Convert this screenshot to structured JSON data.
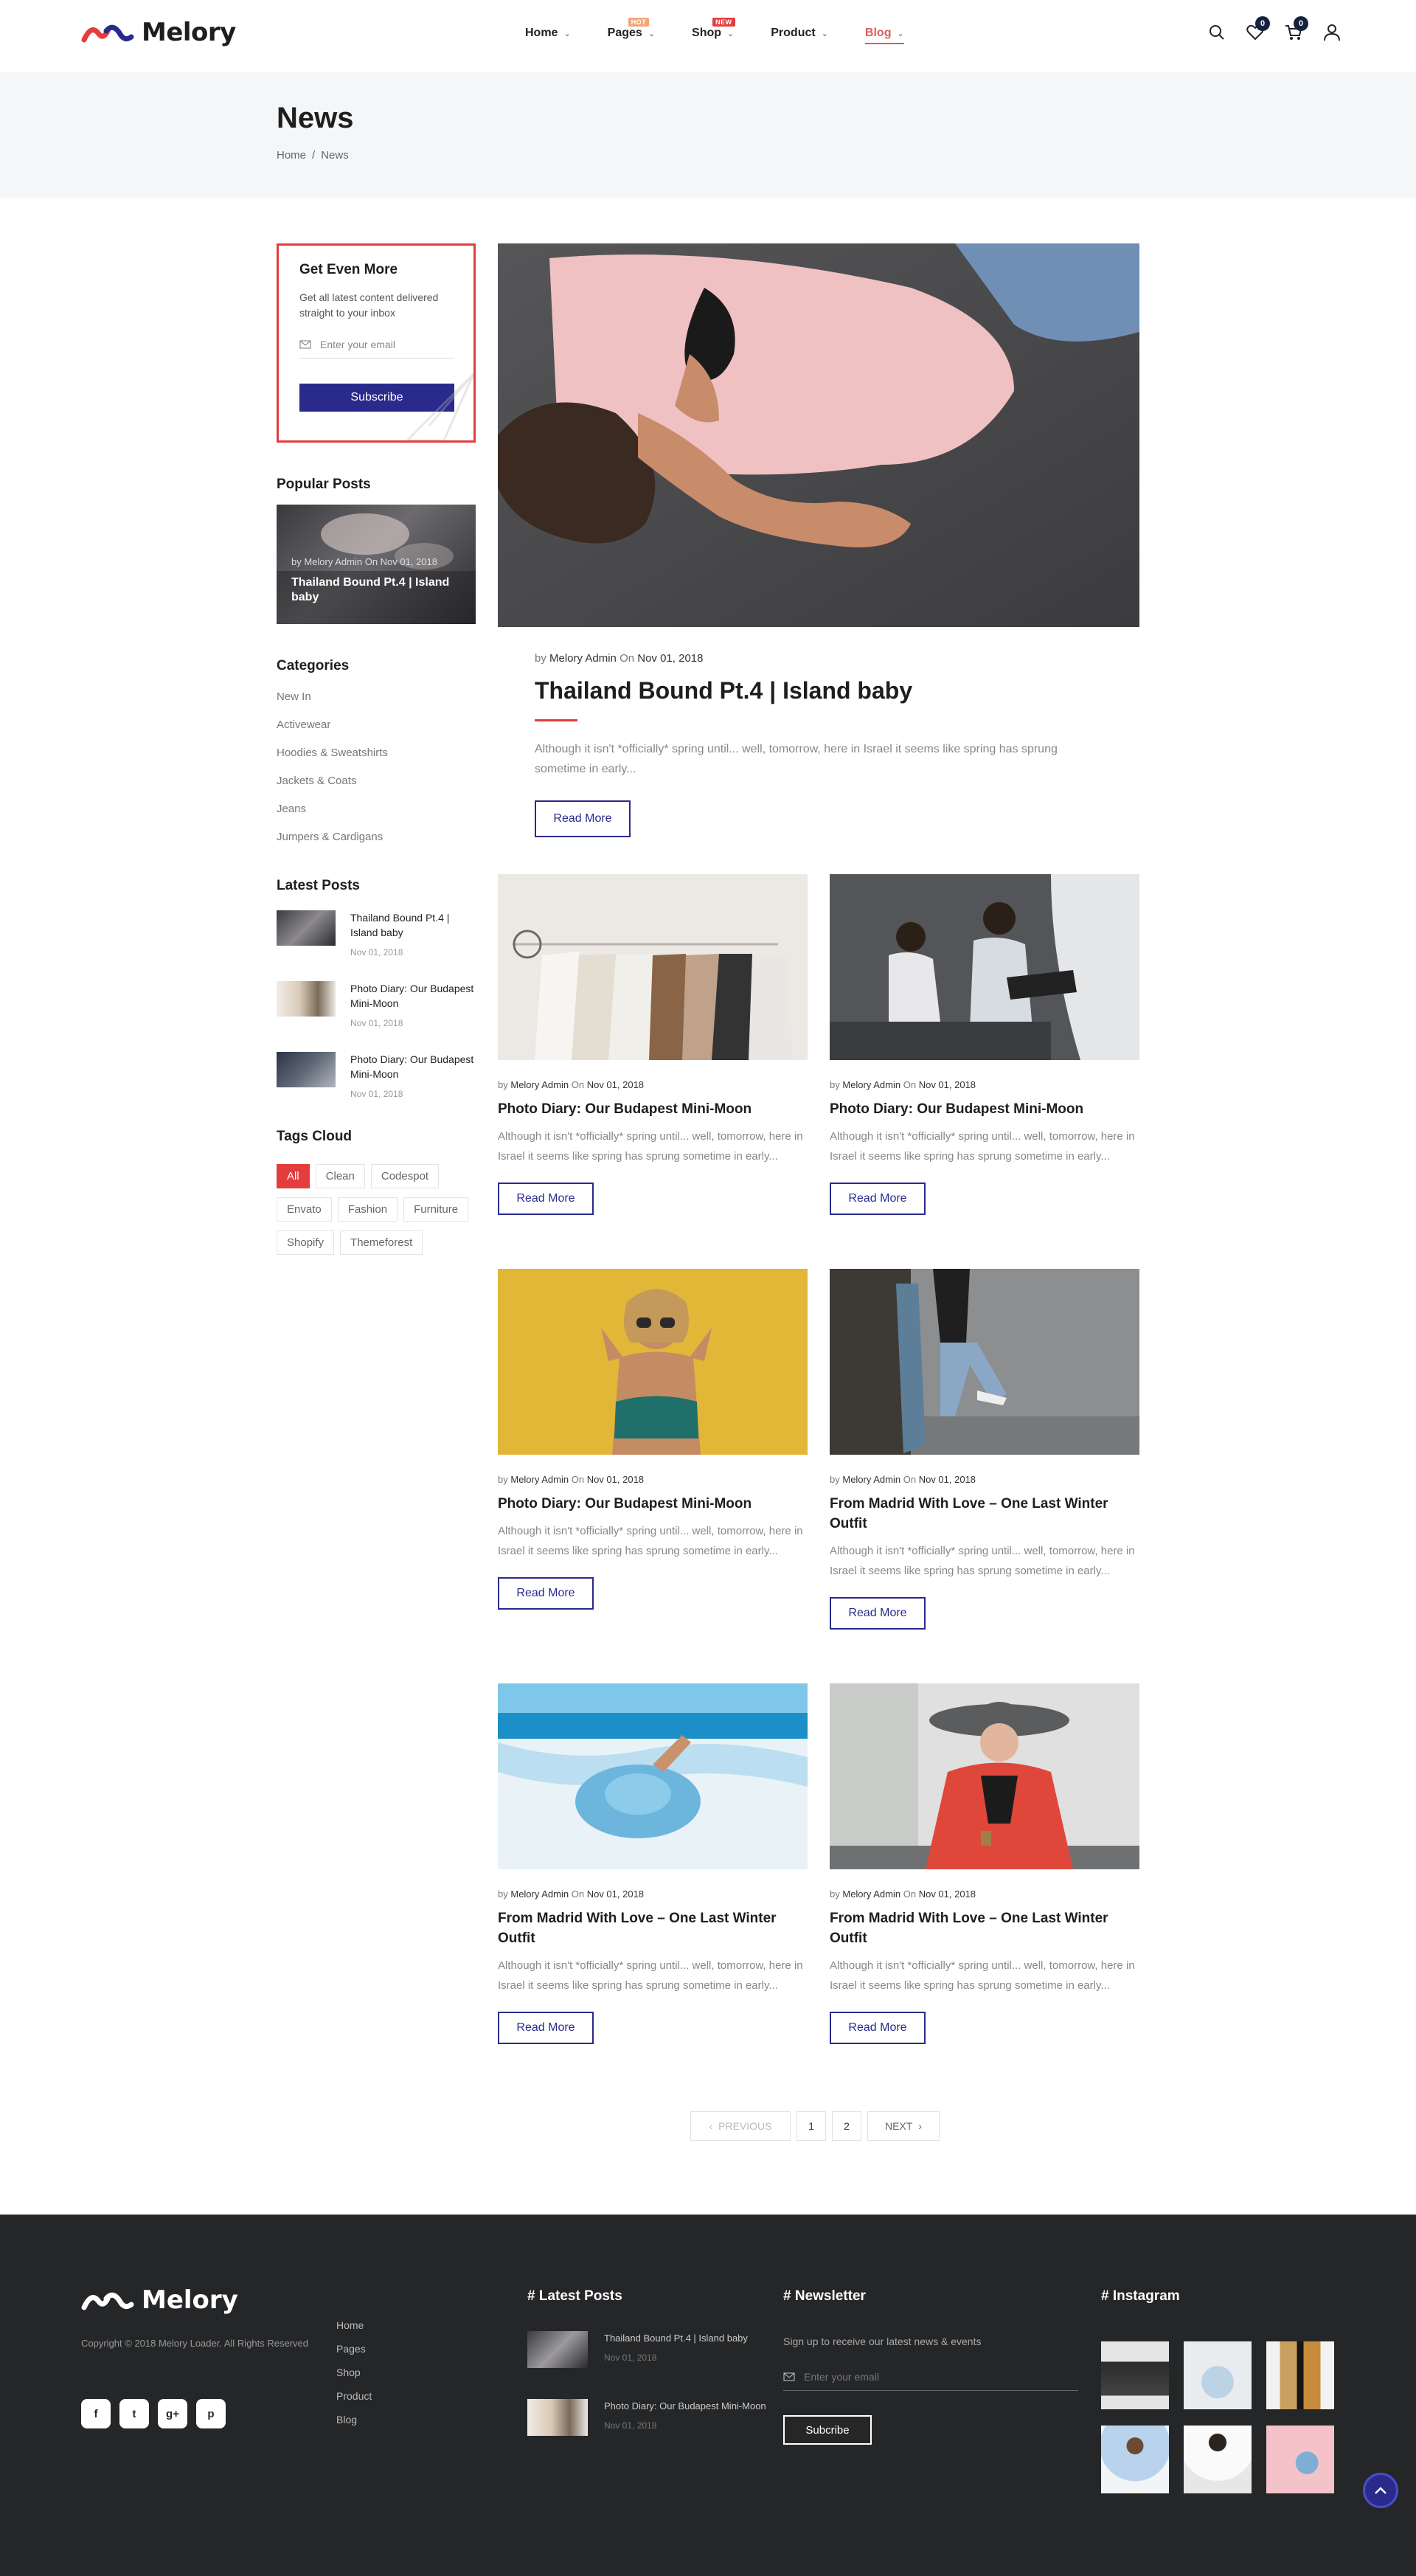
{
  "brand": {
    "name": "Melory"
  },
  "nav": {
    "items": [
      {
        "label": "Home",
        "badge": ""
      },
      {
        "label": "Pages",
        "badge": "HOT"
      },
      {
        "label": "Shop",
        "badge": "NEW"
      },
      {
        "label": "Product",
        "badge": ""
      },
      {
        "label": "Blog",
        "badge": ""
      }
    ],
    "wishlist_count": "0",
    "cart_count": "0"
  },
  "page": {
    "title": "News",
    "breadcrumb": [
      "Home",
      "/",
      "News"
    ]
  },
  "sidebar": {
    "newsletter": {
      "heading": "Get Even More",
      "text": "Get all latest content delivered straight to your inbox",
      "placeholder": "Enter your email",
      "button": "Subscribe"
    },
    "popular": {
      "heading": "Popular Posts",
      "meta": "by Melory Admin On Nov 01, 2018",
      "title": "Thailand Bound Pt.4 | Island baby"
    },
    "categories": {
      "heading": "Categories",
      "items": [
        "New In",
        "Activewear",
        "Hoodies & Sweatshirts",
        "Jackets & Coats",
        "Jeans",
        "Jumpers & Cardigans"
      ]
    },
    "latest": {
      "heading": "Latest Posts",
      "items": [
        {
          "title": "Thailand Bound Pt.4 | Island baby",
          "date": "Nov 01, 2018"
        },
        {
          "title": "Photo Diary: Our Budapest Mini-Moon",
          "date": "Nov 01, 2018"
        },
        {
          "title": "Photo Diary: Our Budapest Mini-Moon",
          "date": "Nov 01, 2018"
        }
      ]
    },
    "tags": {
      "heading": "Tags Cloud",
      "items": [
        "All",
        "Clean",
        "Codespot",
        "Envato",
        "Fashion",
        "Furniture",
        "Shopify",
        "Themeforest"
      ]
    }
  },
  "featured": {
    "by": "by",
    "author": "Melory Admin",
    "on": "On",
    "date": "Nov 01, 2018",
    "title": "Thailand Bound Pt.4 | Island baby",
    "excerpt": "Although it isn't *officially* spring until... well, tomorrow, here in Israel it seems like spring has sprung sometime in early...",
    "button": "Read More"
  },
  "posts": [
    {
      "author": "Melory Admin",
      "date": "Nov 01, 2018",
      "title": "Photo Diary: Our Budapest Mini-Moon",
      "excerpt": "Although it isn't *officially* spring until... well, tomorrow, here in Israel it seems like spring has sprung sometime in early...",
      "button": "Read More"
    },
    {
      "author": "Melory Admin",
      "date": "Nov 01, 2018",
      "title": "Photo Diary: Our Budapest Mini-Moon",
      "excerpt": "Although it isn't *officially* spring until... well, tomorrow, here in Israel it seems like spring has sprung sometime in early...",
      "button": "Read More"
    },
    {
      "author": "Melory Admin",
      "date": "Nov 01, 2018",
      "title": "Photo Diary: Our Budapest Mini-Moon",
      "excerpt": "Although it isn't *officially* spring until... well, tomorrow, here in Israel it seems like spring has sprung sometime in early...",
      "button": "Read More"
    },
    {
      "author": "Melory Admin",
      "date": "Nov 01, 2018",
      "title": "From Madrid With Love – One Last Winter Outfit",
      "excerpt": "Although it isn't *officially* spring until... well, tomorrow, here in Israel it seems like spring has sprung sometime in early...",
      "button": "Read More"
    },
    {
      "author": "Melory Admin",
      "date": "Nov 01, 2018",
      "title": "From Madrid With Love – One Last Winter Outfit",
      "excerpt": "Although it isn't *officially* spring until... well, tomorrow, here in Israel it seems like spring has sprung sometime in early...",
      "button": "Read More"
    },
    {
      "author": "Melory Admin",
      "date": "Nov 01, 2018",
      "title": "From Madrid With Love – One Last Winter Outfit",
      "excerpt": "Although it isn't *officially* spring until... well, tomorrow, here in Israel it seems like spring has sprung sometime in early...",
      "button": "Read More"
    }
  ],
  "post_meta": {
    "by": "by",
    "on": "On"
  },
  "pagination": {
    "prev": "PREVIOUS",
    "pages": [
      "1",
      "2"
    ],
    "next": "NEXT"
  },
  "footer": {
    "brand": "Melory",
    "copyright": "Copyright © 2018 Melory Loader. All Rights Reserved",
    "social": [
      "f",
      "t",
      "g+",
      "p"
    ],
    "links": [
      "Home",
      "Pages",
      "Shop",
      "Product",
      "Blog"
    ],
    "latest_heading": "# Latest Posts",
    "latest": [
      {
        "title": "Thailand Bound Pt.4 | Island baby",
        "date": "Nov 01, 2018"
      },
      {
        "title": "Photo Diary: Our Budapest Mini-Moon",
        "date": "Nov 01, 2018"
      }
    ],
    "newsletter_heading": "# Newsletter",
    "newsletter_text": "Sign up to receive our latest news & events",
    "newsletter_placeholder": "Enter your email",
    "newsletter_button": "Subcribe",
    "instagram_heading": "# Instagram"
  },
  "colors": {
    "accent": "#e33d3d",
    "primary": "#2a2a8c",
    "footer_bg": "#252628"
  }
}
